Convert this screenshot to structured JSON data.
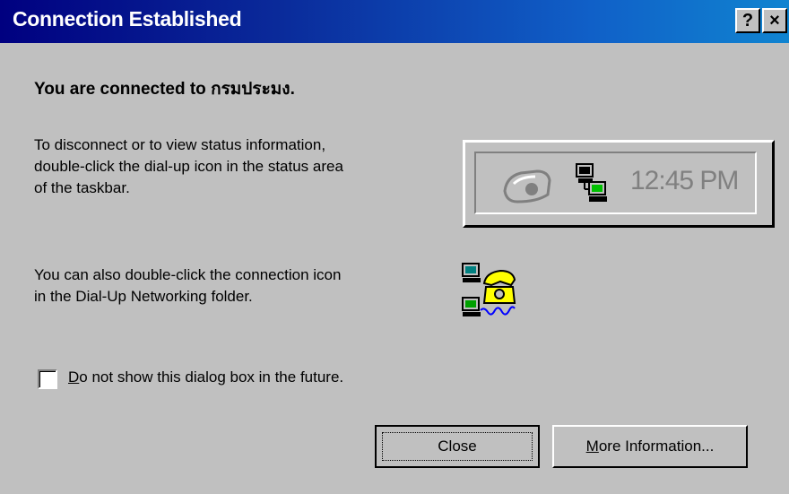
{
  "window": {
    "title": "Connection Established",
    "help_label": "?",
    "close_label": "×"
  },
  "connected_message": "You are connected to กรมประมง.",
  "disconnect_instructions": "To disconnect or to view status information,\ndouble-click the dial-up icon in the status area\nof the taskbar.",
  "tray_preview": {
    "time": "12:45 PM",
    "icons": [
      "phone-icon",
      "network-computers-icon"
    ]
  },
  "folder_instructions": "You can also double-click the connection icon\nin the Dial-Up Networking folder.",
  "connection_icon": "dial-up-connection-icon",
  "dont_show_checkbox": {
    "checked": false,
    "label_mnemonic": "D",
    "label_rest": "o not show this dialog box in the future."
  },
  "buttons": {
    "close_label": "Close",
    "more_info_mnemonic": "M",
    "more_info_rest": "ore Information..."
  }
}
